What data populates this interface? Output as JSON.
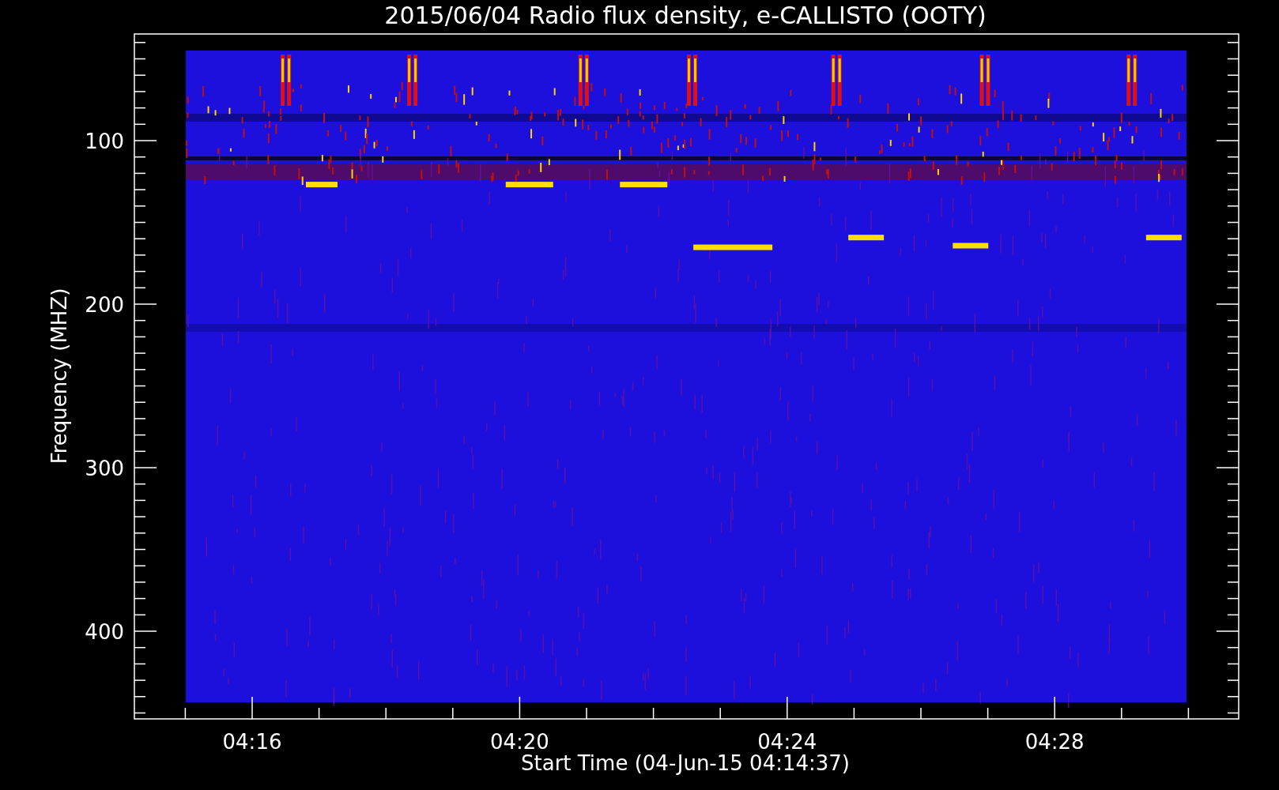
{
  "title": "2015/06/04  Radio flux density, e-CALLISTO (OOTY)",
  "y_axis": {
    "label": "Frequency (MHZ)",
    "ticks": [
      "100",
      "200",
      "300",
      "400"
    ]
  },
  "x_axis": {
    "label": "Start Time (04-Jun-15 04:14:37)",
    "ticks": [
      "04:16",
      "04:20",
      "04:24",
      "04:28"
    ]
  }
}
